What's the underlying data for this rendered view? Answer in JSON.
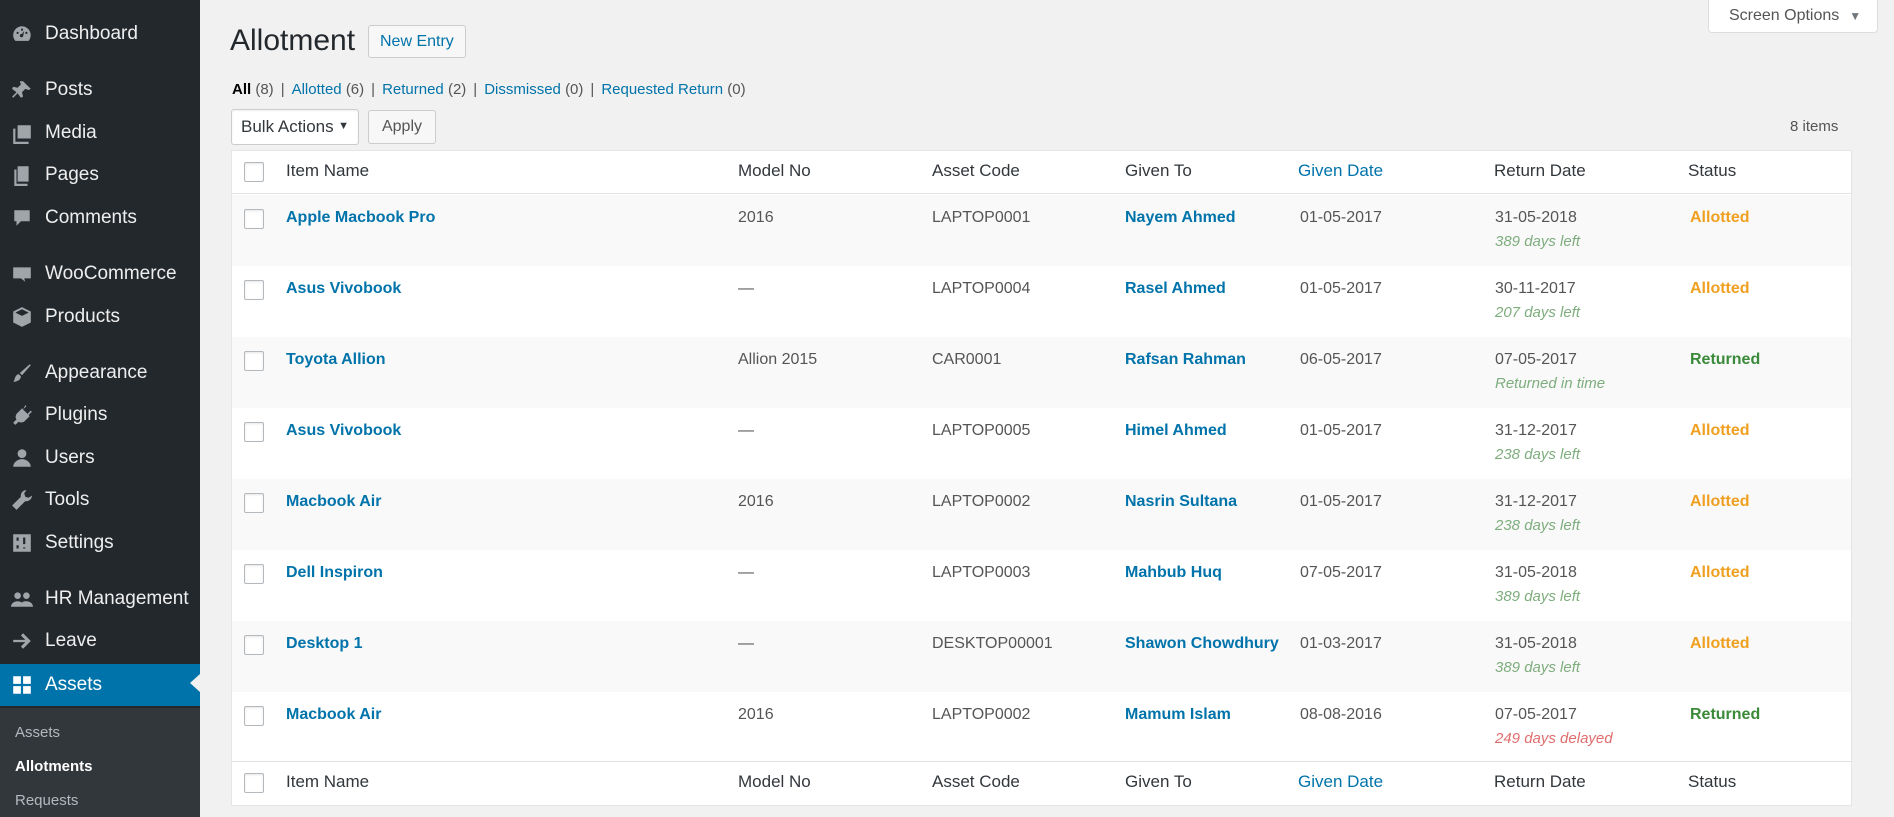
{
  "sidebar": {
    "items": [
      {
        "label": "Dashboard",
        "icon": "dashboard-icon"
      },
      {
        "label": "Posts",
        "icon": "pin-icon"
      },
      {
        "label": "Media",
        "icon": "media-icon"
      },
      {
        "label": "Pages",
        "icon": "pages-icon"
      },
      {
        "label": "Comments",
        "icon": "comment-icon"
      },
      {
        "label": "WooCommerce",
        "icon": "woo-icon"
      },
      {
        "label": "Products",
        "icon": "box-icon"
      },
      {
        "label": "Appearance",
        "icon": "brush-icon"
      },
      {
        "label": "Plugins",
        "icon": "plug-icon"
      },
      {
        "label": "Users",
        "icon": "user-icon"
      },
      {
        "label": "Tools",
        "icon": "wrench-icon"
      },
      {
        "label": "Settings",
        "icon": "sliders-icon"
      },
      {
        "label": "HR Management",
        "icon": "group-icon"
      },
      {
        "label": "Leave",
        "icon": "arrow-right-icon"
      },
      {
        "label": "Assets",
        "icon": "grid-icon"
      }
    ],
    "submenu": [
      "Assets",
      "Allotments",
      "Requests"
    ]
  },
  "header": {
    "title": "Allotment",
    "new_entry": "New Entry",
    "screen_options": "Screen Options"
  },
  "filters": [
    {
      "label": "All",
      "count": "(8)"
    },
    {
      "label": "Allotted",
      "count": "(6)"
    },
    {
      "label": "Returned",
      "count": "(2)"
    },
    {
      "label": "Dissmissed",
      "count": "(0)"
    },
    {
      "label": "Requested Return",
      "count": "(0)"
    }
  ],
  "toolbar": {
    "bulk_actions": "Bulk Actions",
    "apply": "Apply",
    "items_count": "8 items"
  },
  "table": {
    "columns": [
      "Item Name",
      "Model No",
      "Asset Code",
      "Given To",
      "Given Date",
      "Return Date",
      "Status"
    ],
    "rows": [
      {
        "item": "Apple Macbook Pro",
        "model": "2016",
        "code": "LAPTOP0001",
        "given_to": "Nayem Ahmed",
        "given_date": "01-05-2017",
        "return_date": "31-05-2018",
        "note": "389 days left",
        "status": "Allotted"
      },
      {
        "item": "Asus Vivobook",
        "model": "—",
        "code": "LAPTOP0004",
        "given_to": "Rasel Ahmed",
        "given_date": "01-05-2017",
        "return_date": "30-11-2017",
        "note": "207 days left",
        "status": "Allotted"
      },
      {
        "item": "Toyota Allion",
        "model": "Allion 2015",
        "code": "CAR0001",
        "given_to": "Rafsan Rahman",
        "given_date": "06-05-2017",
        "return_date": "07-05-2017",
        "note": "Returned in time",
        "status": "Returned"
      },
      {
        "item": "Asus Vivobook",
        "model": "—",
        "code": "LAPTOP0005",
        "given_to": "Himel Ahmed",
        "given_date": "01-05-2017",
        "return_date": "31-12-2017",
        "note": "238 days left",
        "status": "Allotted"
      },
      {
        "item": "Macbook Air",
        "model": "2016",
        "code": "LAPTOP0002",
        "given_to": "Nasrin Sultana",
        "given_date": "01-05-2017",
        "return_date": "31-12-2017",
        "note": "238 days left",
        "status": "Allotted"
      },
      {
        "item": "Dell Inspiron",
        "model": "—",
        "code": "LAPTOP0003",
        "given_to": "Mahbub Huq",
        "given_date": "07-05-2017",
        "return_date": "31-05-2018",
        "note": "389 days left",
        "status": "Allotted"
      },
      {
        "item": "Desktop 1",
        "model": "—",
        "code": "DESKTOP00001",
        "given_to": "Shawon Chowdhury",
        "given_date": "01-03-2017",
        "return_date": "31-05-2018",
        "note": "389 days left",
        "status": "Allotted"
      },
      {
        "item": "Macbook Air",
        "model": "2016",
        "code": "LAPTOP0002",
        "given_to": "Mamum Islam",
        "given_date": "08-08-2016",
        "return_date": "07-05-2017",
        "note": "249 days delayed",
        "status": "Returned"
      }
    ]
  },
  "colors": {
    "sidebar_bg": "#23282d",
    "active_menu": "#0073aa",
    "link": "#0073aa",
    "status_allotted": "#f0a020",
    "status_returned": "#3a8a3a",
    "note_ok": "#7ead7e",
    "note_delayed": "#e06d6d"
  }
}
